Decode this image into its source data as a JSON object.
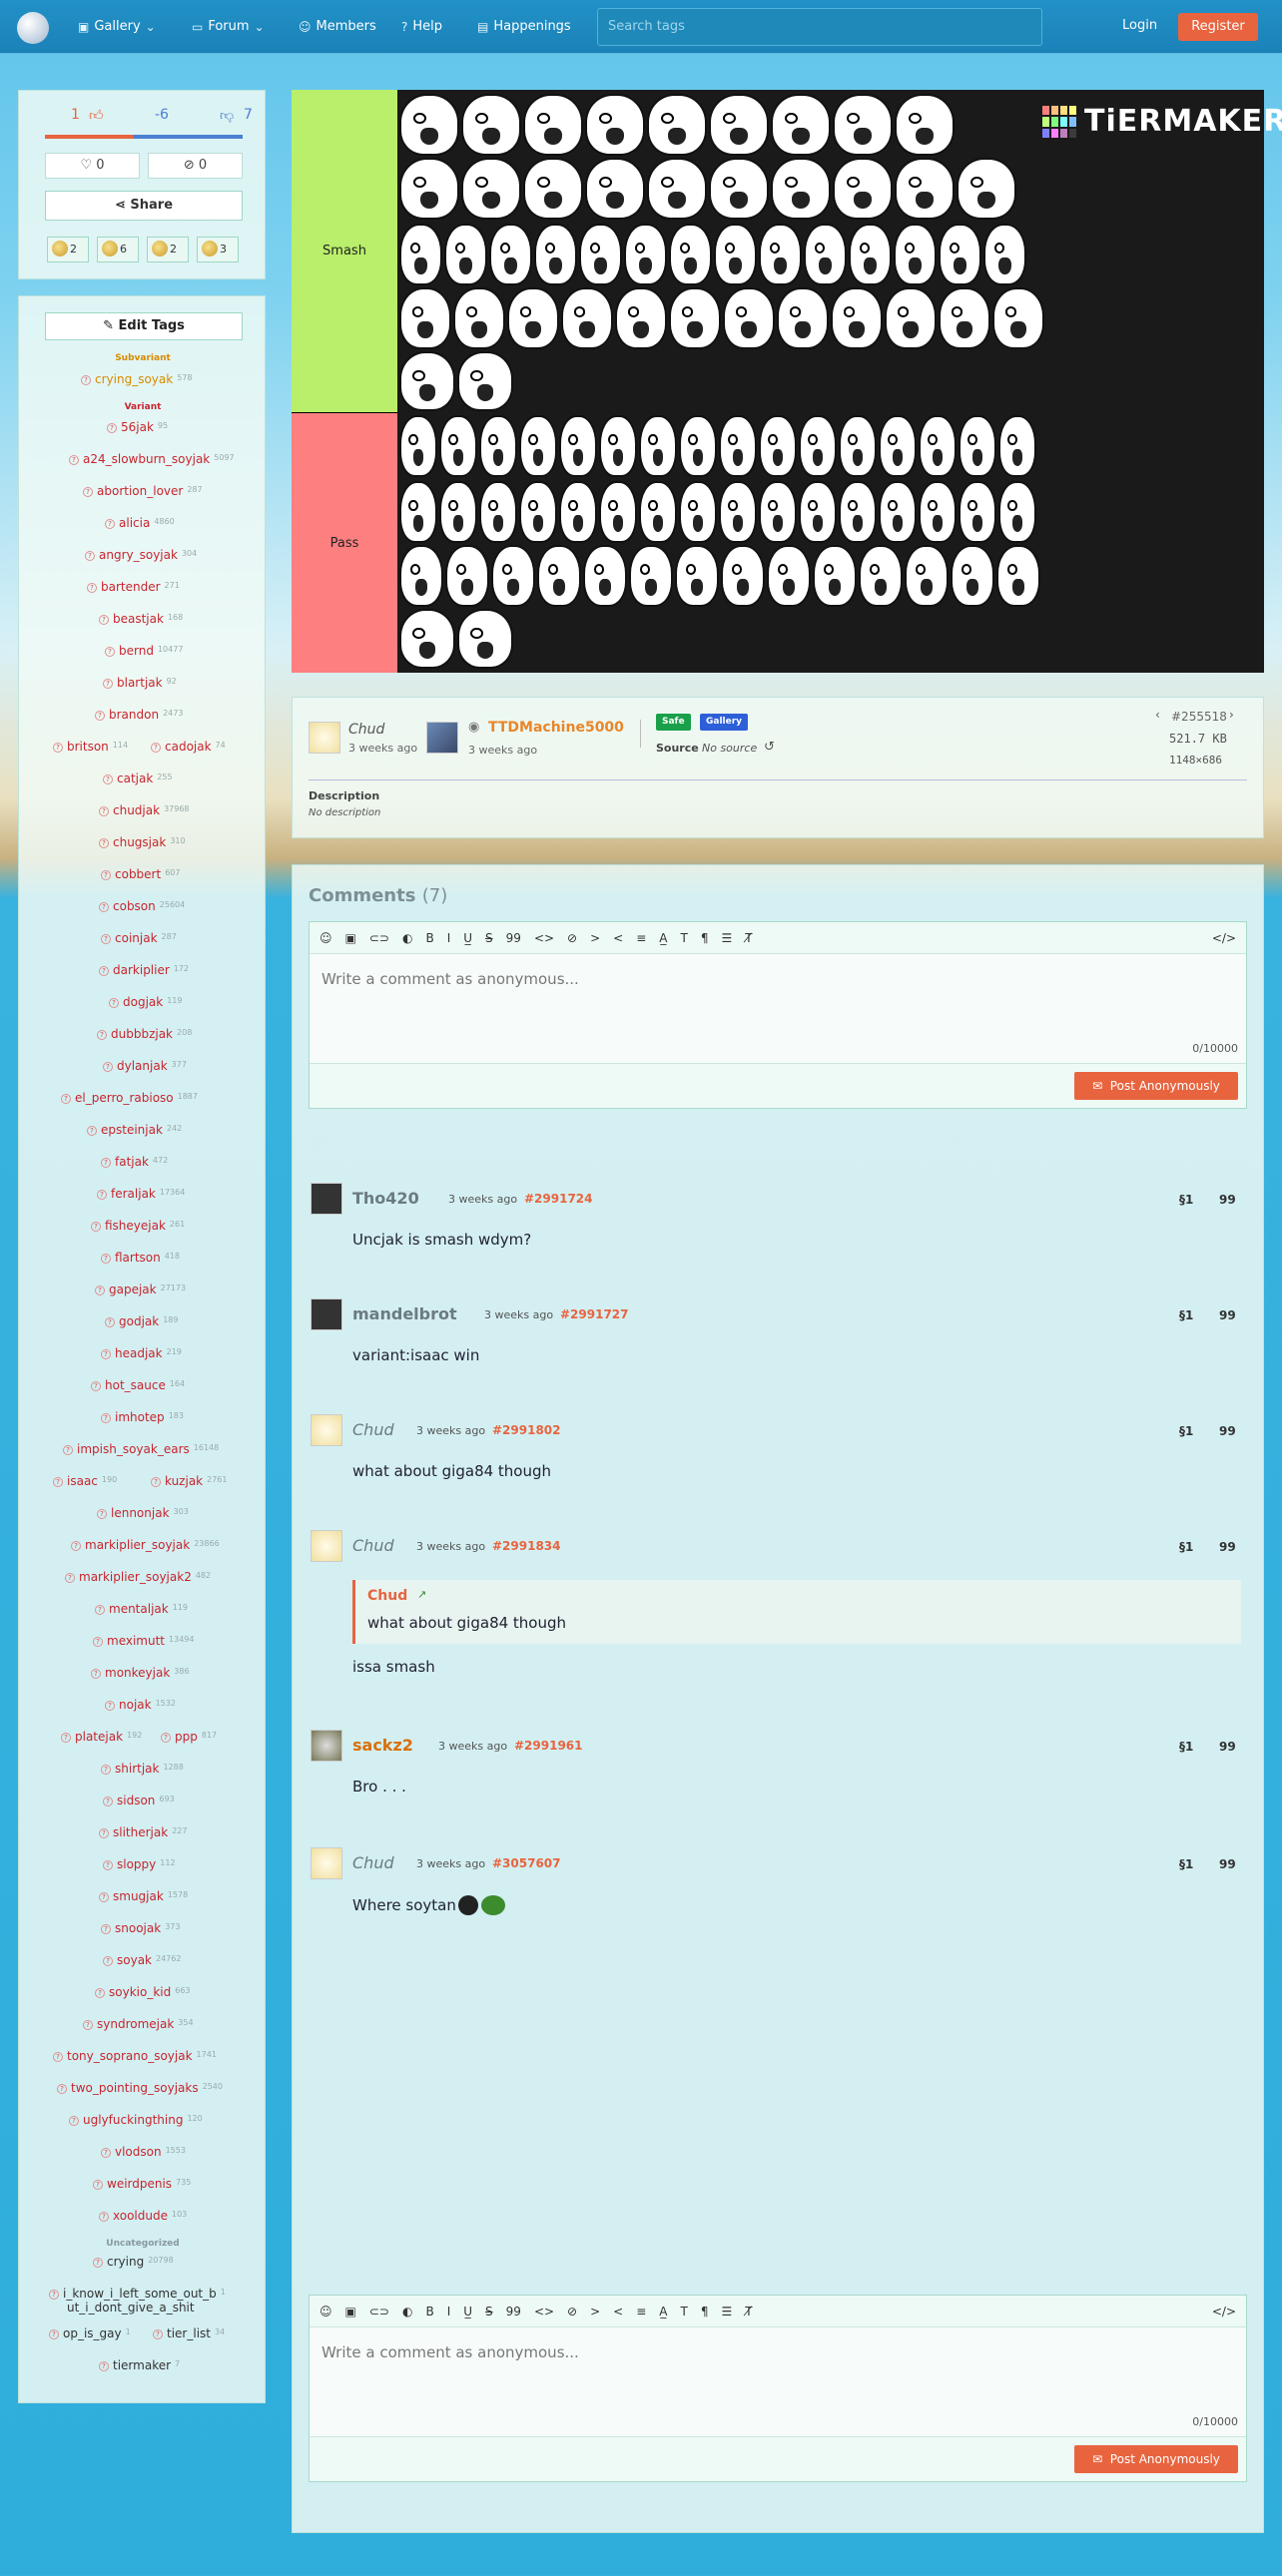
{
  "nav": {
    "items": [
      {
        "label": "Gallery",
        "icon": "gallery-icon",
        "dropdown": true
      },
      {
        "label": "Forum",
        "icon": "forum-icon",
        "dropdown": true
      },
      {
        "label": "Members",
        "icon": "members-icon"
      },
      {
        "label": "Help",
        "icon": "help-icon"
      },
      {
        "label": "Happenings",
        "icon": "happenings-icon"
      }
    ],
    "search_placeholder": "Search tags",
    "login": "Login",
    "register": "Register"
  },
  "votes": {
    "up": "1",
    "score": "-6",
    "down": "7"
  },
  "favorites": {
    "hearts": "0",
    "hidden": "0"
  },
  "share": "Share",
  "reactions": [
    "2",
    "6",
    "2",
    "3"
  ],
  "tags_panel": {
    "edit_label": "Edit Tags",
    "categories": [
      {
        "name": "Subvariant",
        "tags": [
          {
            "name": "crying_soyak",
            "count": "578"
          }
        ]
      },
      {
        "name": "Variant",
        "tags": [
          {
            "name": "56jak",
            "count": "95"
          },
          {
            "name": "a24_slowburn_soyjak",
            "count": "5097"
          },
          {
            "name": "abortion_lover",
            "count": "287"
          },
          {
            "name": "alicia",
            "count": "4860"
          },
          {
            "name": "angry_soyjak",
            "count": "304"
          },
          {
            "name": "bartender",
            "count": "271"
          },
          {
            "name": "beastjak",
            "count": "168"
          },
          {
            "name": "bernd",
            "count": "10477"
          },
          {
            "name": "blartjak",
            "count": "92"
          },
          {
            "name": "brandon",
            "count": "2473"
          },
          {
            "name": "britson",
            "count": "114"
          },
          {
            "name": "cadojak",
            "count": "74"
          },
          {
            "name": "catjak",
            "count": "255"
          },
          {
            "name": "chudjak",
            "count": "37968"
          },
          {
            "name": "chugsjak",
            "count": "310"
          },
          {
            "name": "cobbert",
            "count": "607"
          },
          {
            "name": "cobson",
            "count": "25604"
          },
          {
            "name": "coinjak",
            "count": "287"
          },
          {
            "name": "darkiplier",
            "count": "172"
          },
          {
            "name": "dogjak",
            "count": "119"
          },
          {
            "name": "dubbbzjak",
            "count": "208"
          },
          {
            "name": "dylanjak",
            "count": "377"
          },
          {
            "name": "el_perro_rabioso",
            "count": "1887"
          },
          {
            "name": "epsteinjak",
            "count": "242"
          },
          {
            "name": "fatjak",
            "count": "472"
          },
          {
            "name": "feraljak",
            "count": "17364"
          },
          {
            "name": "fisheyejak",
            "count": "261"
          },
          {
            "name": "flartson",
            "count": "418"
          },
          {
            "name": "gapejak",
            "count": "27173"
          },
          {
            "name": "godjak",
            "count": "189"
          },
          {
            "name": "headjak",
            "count": "219"
          },
          {
            "name": "hot_sauce",
            "count": "164"
          },
          {
            "name": "imhotep",
            "count": "183"
          },
          {
            "name": "impish_soyak_ears",
            "count": "16148"
          },
          {
            "name": "isaac",
            "count": "190"
          },
          {
            "name": "kuzjak",
            "count": "2761"
          },
          {
            "name": "lennonjak",
            "count": "303"
          },
          {
            "name": "markiplier_soyjak",
            "count": "23866"
          },
          {
            "name": "markiplier_soyjak2",
            "count": "482"
          },
          {
            "name": "mentaljak",
            "count": "119"
          },
          {
            "name": "meximutt",
            "count": "13494"
          },
          {
            "name": "monkeyjak",
            "count": "386"
          },
          {
            "name": "nojak",
            "count": "1532"
          },
          {
            "name": "platejak",
            "count": "192"
          },
          {
            "name": "ppp",
            "count": "817"
          },
          {
            "name": "shirtjak",
            "count": "1288"
          },
          {
            "name": "sidson",
            "count": "693"
          },
          {
            "name": "slitherjak",
            "count": "227"
          },
          {
            "name": "sloppy",
            "count": "112"
          },
          {
            "name": "smugjak",
            "count": "1578"
          },
          {
            "name": "snoojak",
            "count": "373"
          },
          {
            "name": "soyak",
            "count": "24762"
          },
          {
            "name": "soykio_kid",
            "count": "663"
          },
          {
            "name": "syndromejak",
            "count": "354"
          },
          {
            "name": "tony_soprano_soyjak",
            "count": "1741"
          },
          {
            "name": "two_pointing_soyjaks",
            "count": "2540"
          },
          {
            "name": "uglyfuckingthing",
            "count": "120"
          },
          {
            "name": "vlodson",
            "count": "1553"
          },
          {
            "name": "weirdpenis",
            "count": "735"
          },
          {
            "name": "xooldude",
            "count": "103"
          }
        ]
      },
      {
        "name": "Uncategorized",
        "tags": [
          {
            "name": "crying",
            "count": "20798"
          },
          {
            "name": "i_know_i_left_some_out_b",
            "count": "1"
          },
          {
            "name": "ut_i_dont_give_a_shit",
            "count": ""
          },
          {
            "name": "op_is_gay",
            "count": "1"
          },
          {
            "name": "tier_list",
            "count": "34"
          },
          {
            "name": "tiermaker",
            "count": "7"
          }
        ]
      }
    ]
  },
  "tierlist": {
    "logo_text": "TiERMAKER",
    "tiers": [
      "Smash",
      "Pass"
    ]
  },
  "post_info": {
    "uploader": "Chud",
    "uploader_time": "3 weeks ago",
    "approver": "TTDMachine5000",
    "approver_time": "3 weeks ago",
    "badges": [
      {
        "label": "Safe",
        "color": "#1aa04a"
      },
      {
        "label": "Gallery",
        "color": "#2d5fd8"
      }
    ],
    "source_label": "Source",
    "source_value": "No source",
    "post_id": "#255518",
    "file_size": "521.7 KB",
    "dimensions": "1148×686",
    "description_label": "Description",
    "description_value": "No description"
  },
  "comments": {
    "title": "Comments",
    "count": "(7)",
    "placeholder": "Write a comment as anonymous...",
    "char_count": "0/10000",
    "post_button": "Post Anonymously",
    "list": [
      {
        "author": "Tho420",
        "time": "3 weeks ago",
        "id": "#2991724",
        "body": "Uncjak is smash wdym?"
      },
      {
        "author": "mandelbrot",
        "time": "3 weeks ago",
        "id": "#2991727",
        "body": "variant:isaac win"
      },
      {
        "author": "Chud",
        "time": "3 weeks ago",
        "id": "#2991802",
        "body": "what about giga84 though"
      },
      {
        "author": "Chud",
        "time": "3 weeks ago",
        "id": "#2991834",
        "quote_author": "Chud",
        "quote_body": "what about giga84 though",
        "body": "issa smash"
      },
      {
        "author": "sackz2",
        "time": "3 weeks ago",
        "id": "#2991961",
        "body": "Bro . . ."
      },
      {
        "author": "Chud",
        "time": "3 weeks ago",
        "id": "#3057607",
        "body": "Where soytan"
      }
    ]
  }
}
